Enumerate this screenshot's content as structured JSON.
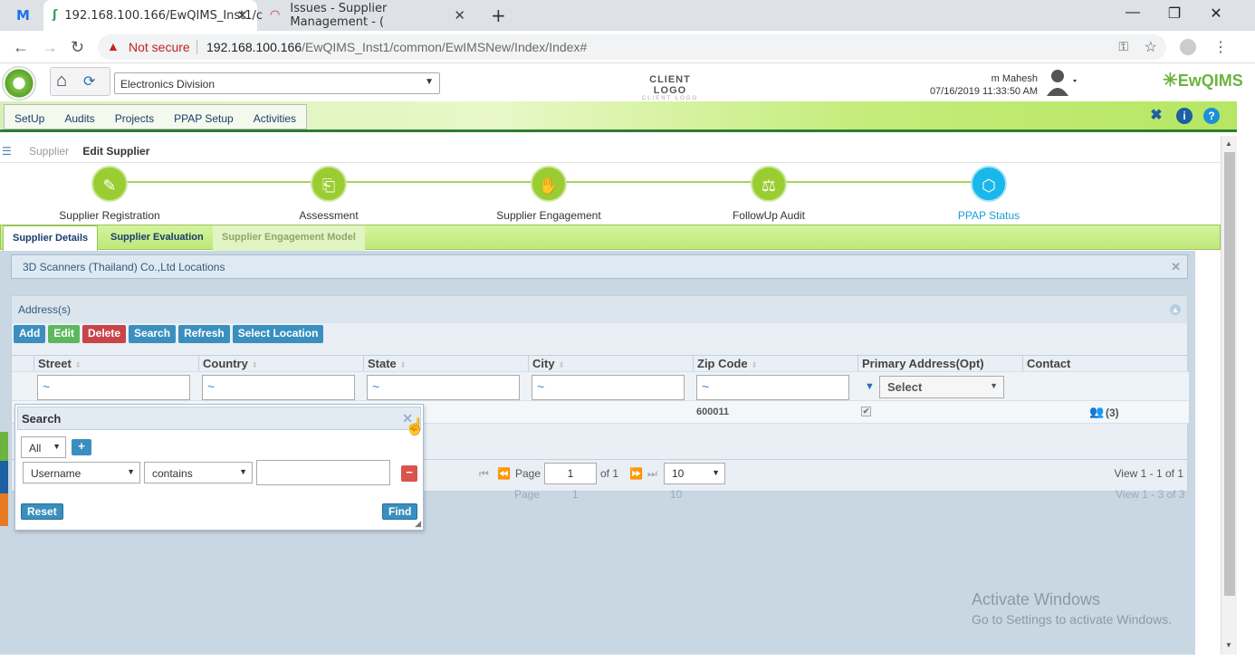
{
  "browser": {
    "tabs": [
      {
        "title": "192.168.100.166/EwQIMS_Inst1/c",
        "active": true
      },
      {
        "title": "Issues - Supplier Management - (",
        "active": false
      }
    ],
    "new_tab": "+",
    "security": "Not secure",
    "url_host": "192.168.100.166",
    "url_path": "/EwQIMS_Inst1/common/EwIMSNew/Index/Index#"
  },
  "header": {
    "division": "Electronics Division",
    "client_logo": "CLIENT LOGO",
    "client_logo_sub": "CLIENT LOGO",
    "user_name": "m Mahesh",
    "datetime": "07/16/2019 11:33:50 AM",
    "brand": "EwQIMS"
  },
  "menu": [
    "SetUp",
    "Audits",
    "Projects",
    "PPAP Setup",
    "Activities"
  ],
  "breadcrumb": {
    "parent": "Supplier",
    "current": "Edit Supplier"
  },
  "steps": [
    {
      "label": "Supplier Registration",
      "icon": "registration-icon"
    },
    {
      "label": "Assessment",
      "icon": "assessment-icon"
    },
    {
      "label": "Supplier Engagement",
      "icon": "handshake-icon"
    },
    {
      "label": "FollowUp Audit",
      "icon": "audit-icon"
    },
    {
      "label": "PPAP Status",
      "icon": "cube-icon"
    }
  ],
  "subtabs": [
    "Supplier Details",
    "Supplier Evaluation",
    "Supplier Engagement Model"
  ],
  "locations_title": "3D Scanners (Thailand) Co.,Ltd Locations",
  "addresses": {
    "title": "Address(s)",
    "toolbar": [
      "Add",
      "Edit",
      "Delete",
      "Search",
      "Refresh",
      "Select Location"
    ],
    "columns": [
      "Street",
      "Country",
      "State",
      "City",
      "Zip Code",
      "Primary Address(Opt)",
      "Contact"
    ],
    "filter_placeholder": "~",
    "primary_filter": "Select",
    "row": {
      "zip": "600011",
      "primary": true,
      "contacts": "(3)"
    },
    "pager": {
      "page_label": "Page",
      "page": "1",
      "of": "of 1",
      "page_size": "10",
      "view": "View 1 - 1 of 1"
    },
    "ghost_pager": {
      "page_label": "Page",
      "page": "1",
      "page_size": "10",
      "view": "View 1 - 3 of 3"
    }
  },
  "search_dialog": {
    "title": "Search",
    "group_op": "All",
    "field": "Username",
    "operator": "contains",
    "value": "",
    "reset": "Reset",
    "find": "Find"
  },
  "watermark": {
    "line1": "Activate Windows",
    "line2": "Go to Settings to activate Windows."
  },
  "colors": {
    "green": "#9acd32",
    "blue_step": "#1ab7ea",
    "add": "#3a8fbf",
    "edit": "#5cb85c",
    "delete": "#c9444a"
  }
}
